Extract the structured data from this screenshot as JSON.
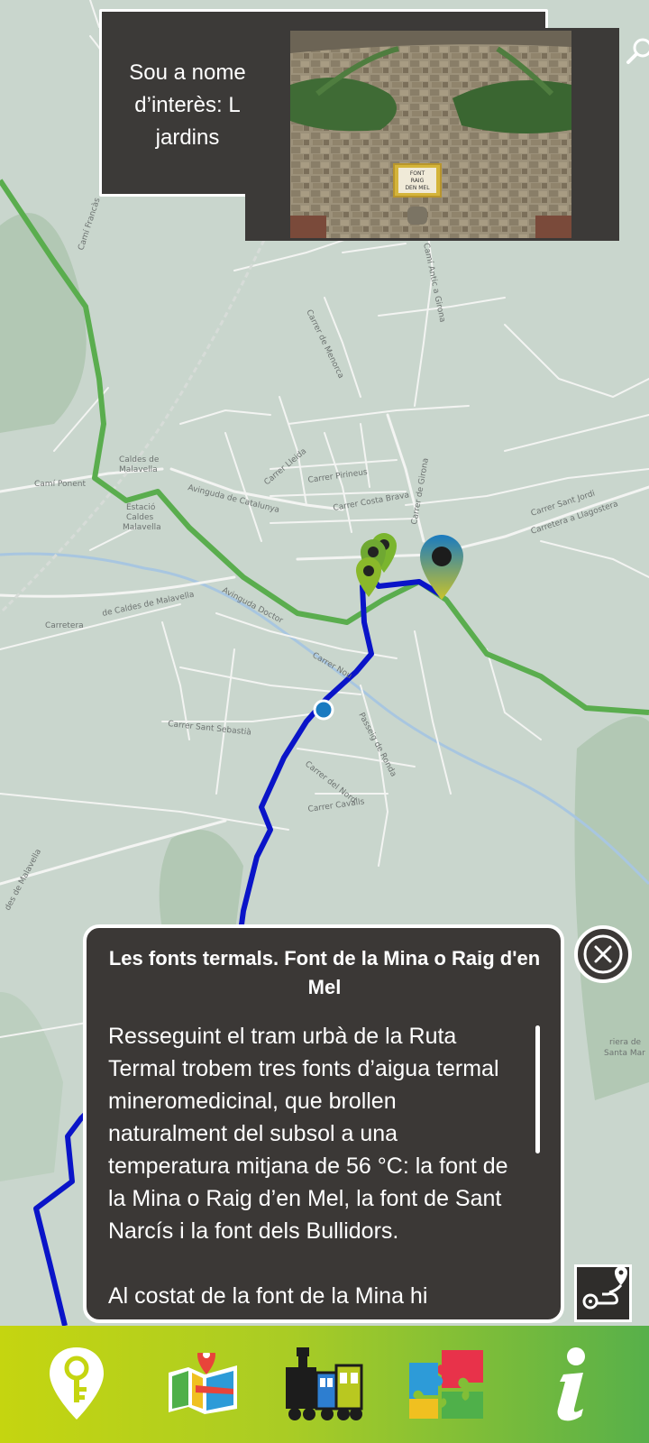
{
  "map": {
    "labels": {
      "cami_ponent": "Camí Ponent",
      "caldes_line1": "Caldes de",
      "caldes_line2": "Malavella",
      "estacio_line1": "Estació",
      "estacio_line2": "Caldes",
      "estacio_line3": "Malavella",
      "av_catalunya": "Avinguda de Catalunya",
      "carrer_lleida": "Carrer Lleida",
      "carrer_pirineus": "Carrer Pirineus",
      "carrer_costa_brava": "Carrer Costa Brava",
      "carrer_girona": "Carrer de Girona",
      "carrer_sant_jordi": "Carrer Sant Jordi",
      "carretera_llagostera": "Carretera a Llagostera",
      "carretera": "Carretera",
      "de_caldes": "de Caldes de Malavella",
      "av_doctor": "Avinguda Doctor",
      "carrer_nou": "Carrer Nou",
      "carrer_sant_sebastia": "Carrer Sant Sebastià",
      "passeig_ronda": "Passeig de Ronda",
      "carrer_nord": "Carrer del Nord",
      "carrer_cavalls": "Carrer Cavalls",
      "carrer_menorca": "Carrer de Menorca",
      "cami_antic": "Camí Antic a Girona",
      "cami_francas": "Camí Francàs",
      "riera_1": "riera de",
      "riera_2": "Santa Mar",
      "malavella_side": "des de Malavella"
    }
  },
  "poi_popup": {
    "text": "Sou a nome d’interès: L jardins",
    "photo_sign": [
      "FONT",
      "RAIG",
      "DEN MEL"
    ]
  },
  "info_panel": {
    "title": "Les fonts termals. Font de la Mina o Raig d'en Mel",
    "paragraph_1": "Resseguint el tram urbà de la Ruta Termal trobem tres fonts d’aigua termal mineromedicinal, que brollen naturalment del subsol a una temperatura mitjana de 56 °C: la font de la Mina o Raig d’en Mel, la font de Sant Narcís i la font dels Bullidors.",
    "paragraph_2": "Al costat de la font de la Mina hi"
  },
  "colors": {
    "route_green": "#5aad4e",
    "route_blue": "#0a14c8",
    "panel_bg": "#3b3836",
    "map_bg": "#c9d6cd",
    "pin_blue": "#1a7ac0",
    "pin_green": "#8ab82a"
  },
  "icons": {
    "zoom": "magnifier-icon",
    "close": "close-circle-icon",
    "route": "route-icon",
    "nav": [
      "key-pin-icon",
      "map-icon",
      "train-icon",
      "puzzle-icon",
      "info-icon"
    ]
  }
}
